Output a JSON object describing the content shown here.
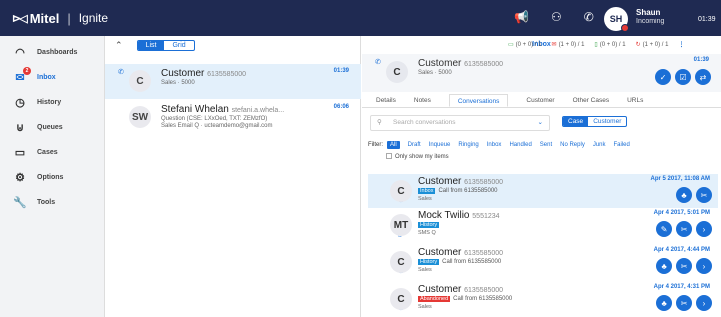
{
  "topbar": {
    "brand": "Mitel",
    "product": "Ignite",
    "icons": [
      "megaphone-icon",
      "contacts-icon",
      "phone-icon"
    ],
    "user_initials": "SH",
    "user_name": "Shaun",
    "user_status": "Incoming",
    "clock": "01:39"
  },
  "sidebar": {
    "items": [
      {
        "label": "Dashboards",
        "icon": "dashboard-icon"
      },
      {
        "label": "Inbox",
        "icon": "inbox-icon",
        "badge": "2",
        "active": true
      },
      {
        "label": "History",
        "icon": "history-icon"
      },
      {
        "label": "Queues",
        "icon": "queues-icon"
      },
      {
        "label": "Cases",
        "icon": "folder-icon"
      },
      {
        "label": "Options",
        "icon": "gear-icon"
      },
      {
        "label": "Tools",
        "icon": "wrench-icon"
      }
    ]
  },
  "list": {
    "view_list": "List",
    "view_grid": "Grid",
    "conversations": [
      {
        "initials": "C",
        "name": "Customer",
        "number": "6135585000",
        "sub1": "Sales · 5000",
        "time": "01:39"
      },
      {
        "initials": "SW",
        "name": "Stefani Whelan",
        "number": "stefani.a.whela...",
        "sub1": "Question (CSE: LXxOed, TXT: ZEMzfO)",
        "sub2": "Sales Email Q · ucteamdemo@gmail.com",
        "time": "06:06"
      }
    ]
  },
  "detail": {
    "header": "Inbox",
    "legend": [
      "(0 + 0) / 1",
      "(1 + 0) / 1",
      "(0 + 0) / 1",
      "(1 + 0) / 1"
    ],
    "card": {
      "initials": "C",
      "name": "Customer",
      "number": "6135585000",
      "sub": "Sales · 5000",
      "time": "01:39"
    },
    "tabs": [
      "Details",
      "Notes",
      "Conversations",
      "Customer",
      "Other Cases",
      "URLs"
    ],
    "search_placeholder": "Search conversations",
    "toggle_case": "Case",
    "toggle_customer": "Customer",
    "filter_label": "Filter:",
    "filters": [
      "All",
      "Draft",
      "Inqueue",
      "Ringing",
      "Inbox",
      "Handled",
      "Sent",
      "No Reply",
      "Junk",
      "Failed"
    ],
    "show_mine": "Only show my items",
    "history": [
      {
        "initials": "C",
        "name": "Customer",
        "number": "6135585000",
        "tag": "Inbox",
        "desc": "Call from 6135585000",
        "queue": "Sales",
        "date": "Apr 5 2017, 11:08 AM"
      },
      {
        "initials": "MT",
        "name": "Mock Twilio",
        "number": "5551234",
        "tag": "History",
        "desc": "",
        "queue": "SMS Q",
        "date": "Apr 4 2017, 5:01 PM"
      },
      {
        "initials": "C",
        "name": "Customer",
        "number": "6135585000",
        "tag": "History",
        "desc": "Call from 6135585000",
        "queue": "Sales",
        "date": "Apr 4 2017, 4:44 PM"
      },
      {
        "initials": "C",
        "name": "Customer",
        "number": "6135585000",
        "tag": "Abandoned",
        "desc": "Call from 6135585000",
        "queue": "Sales",
        "date": "Apr 4 2017, 4:31 PM"
      }
    ]
  }
}
